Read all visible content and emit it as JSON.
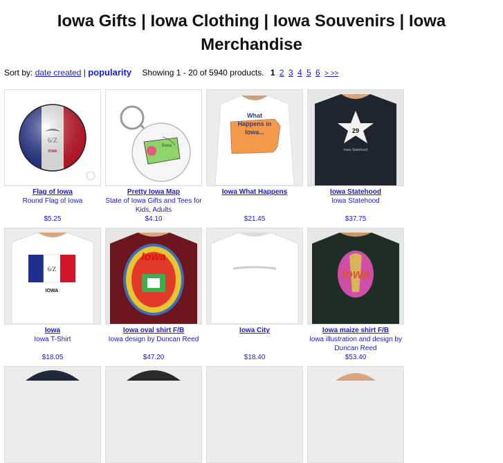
{
  "page": {
    "title": "Iowa Gifts | Iowa Clothing | Iowa Souvenirs | Iowa Merchandise"
  },
  "sort": {
    "label": "Sort by:",
    "date_created": "date created",
    "separator": "|",
    "popularity": "popularity",
    "showing": "Showing 1 - 20 of 5940 products.",
    "current_page": "1",
    "pages": [
      "2",
      "3",
      "4",
      "5",
      "6"
    ],
    "next": "> >>"
  },
  "products": [
    {
      "name": "Flag of Iowa",
      "desc": "Round Flag of Iowa",
      "price": "$5.25",
      "image": "round-flag-button"
    },
    {
      "name": "Pretty Iowa Map",
      "desc": "State of Iowa Gifts and Tees for Kids, Adults",
      "price": "$4.10",
      "image": "keychain-map"
    },
    {
      "name": "Iowa What Happens",
      "desc": "",
      "price": "$21.45",
      "image": "white-tshirt-orange-map"
    },
    {
      "name": "Iowa Statehood",
      "desc": "Iowa Statehood",
      "price": "$37.75",
      "image": "navy-tshirt-star",
      "star_text": "29",
      "tag": "Iowa Statehood"
    },
    {
      "name": "Iowa",
      "desc": "Iowa T-Shirt",
      "price": "$18.05",
      "image": "white-tshirt-flag",
      "flag_text": "IOWA"
    },
    {
      "name": "Iowa oval shirt F/B",
      "desc": "Iowa design by Duncan Reed",
      "price": "$47.20",
      "image": "maroon-tshirt-oval",
      "logo_text": "Iowa"
    },
    {
      "name": "Iowa City",
      "desc": "",
      "price": "$18.40",
      "image": "white-tshirt-plain"
    },
    {
      "name": "Iowa maize shirt F/B",
      "desc": "Iowa illustration and design by Duncan Reed",
      "price": "$53.40",
      "image": "green-tshirt-maize",
      "logo_text": "Iowa"
    }
  ],
  "map_text": "What Happens in Iowa...",
  "keychain_label": "Iowa"
}
